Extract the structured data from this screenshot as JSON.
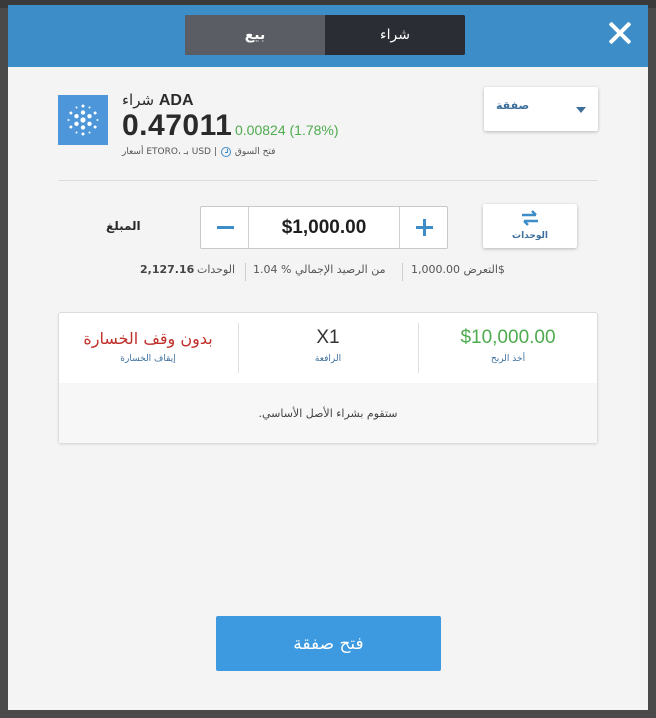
{
  "header": {
    "tabs": [
      {
        "label": "بيع",
        "active": true
      },
      {
        "label": "شراء",
        "active": false
      }
    ]
  },
  "instrument": {
    "action": "شراء",
    "symbol": "ADA",
    "price": "0.47011",
    "change": "0.00824 (1.78%)",
    "market_status": "فتح السوق",
    "source": "أسعار ETORO، بـ USD |"
  },
  "order_type": {
    "label": "صفقة"
  },
  "units_toggle": {
    "label": "الوحدات"
  },
  "amount": {
    "label": "المبلغ",
    "value": "$1,000.00"
  },
  "info": {
    "exposure": "التعرض 1,000.00$",
    "balance_pct": "من الرصيد الإجمالي % 1.04",
    "units_label": "الوحدات",
    "units_value": "2,127.16"
  },
  "trade_card": {
    "stop_loss": {
      "value": "بدون وقف الخسارة",
      "label": "إيقاف الخسارة"
    },
    "leverage": {
      "value": "X1",
      "label": "الرافعة"
    },
    "take_profit": {
      "value": "$10,000.00",
      "label": "أخذ الربح"
    },
    "note": ".ستقوم بشراء الأصل الأساسي"
  },
  "submit": {
    "label": "فتح صفقة"
  },
  "colors": {
    "header": "#3d8dc8",
    "accent": "#3d9ae0",
    "positive": "#4fab4f",
    "negative": "#c0302b"
  }
}
